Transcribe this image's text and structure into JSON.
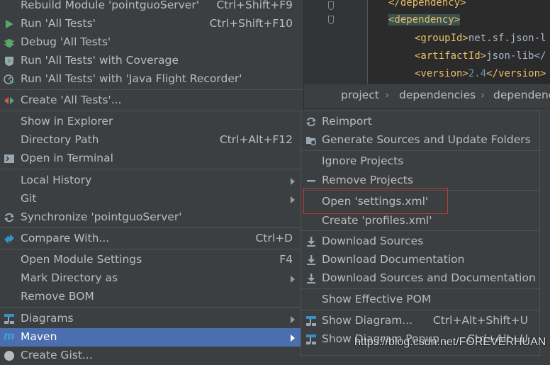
{
  "editor": {
    "line1_tag_close": "</dependency>",
    "line2_tag_open": "<dependency>",
    "line3_tag_open": "<groupId>",
    "line3_text": "net.sf.json-l",
    "line4_tag_open": "<artifactId>",
    "line4_text": "json-lib</",
    "line5_tag_open": "<version>",
    "line5_text": "2.4",
    "line5_tag_close": "</version>"
  },
  "breadcrumb": {
    "items": [
      "project",
      "dependencies",
      "dependenc"
    ]
  },
  "main_menu": {
    "items": [
      {
        "label": "Rebuild Module 'pointguoServer'",
        "shortcut": "Ctrl+Shift+F9"
      },
      {
        "label": "Run 'All Tests'",
        "shortcut": "Ctrl+Shift+F10"
      },
      {
        "label": "Debug 'All Tests'",
        "shortcut": ""
      },
      {
        "label": "Run 'All Tests' with Coverage",
        "shortcut": ""
      },
      {
        "label": "Run 'All Tests' with 'Java Flight Recorder'",
        "shortcut": ""
      },
      {
        "label": "Create 'All Tests'...",
        "shortcut": ""
      },
      {
        "label": "Show in Explorer",
        "shortcut": ""
      },
      {
        "label": "Directory Path",
        "shortcut": "Ctrl+Alt+F12"
      },
      {
        "label": "Open in Terminal",
        "shortcut": ""
      },
      {
        "label": "Local History",
        "shortcut": ""
      },
      {
        "label": "Git",
        "shortcut": ""
      },
      {
        "label": "Synchronize 'pointguoServer'",
        "shortcut": ""
      },
      {
        "label": "Compare With...",
        "shortcut": "Ctrl+D"
      },
      {
        "label": "Open Module Settings",
        "shortcut": "F4"
      },
      {
        "label": "Mark Directory as",
        "shortcut": ""
      },
      {
        "label": "Remove BOM",
        "shortcut": ""
      },
      {
        "label": "Diagrams",
        "shortcut": ""
      },
      {
        "label": "Maven",
        "shortcut": ""
      },
      {
        "label": "Create Gist...",
        "shortcut": ""
      }
    ]
  },
  "sub_menu": {
    "items": [
      {
        "label": "Reimport",
        "shortcut": ""
      },
      {
        "label": "Generate Sources and Update Folders",
        "shortcut": ""
      },
      {
        "label": "Ignore Projects",
        "shortcut": ""
      },
      {
        "label": "Remove Projects",
        "shortcut": ""
      },
      {
        "label": "Open 'settings.xml'",
        "shortcut": ""
      },
      {
        "label": "Create 'profiles.xml'",
        "shortcut": ""
      },
      {
        "label": "Download Sources",
        "shortcut": ""
      },
      {
        "label": "Download Documentation",
        "shortcut": ""
      },
      {
        "label": "Download Sources and Documentation",
        "shortcut": ""
      },
      {
        "label": "Show Effective POM",
        "shortcut": ""
      },
      {
        "label": "Show Diagram...",
        "shortcut": "Ctrl+Alt+Shift+U"
      },
      {
        "label": "Show Diagram Popup...",
        "shortcut": "Ctrl+Alt+U"
      }
    ]
  },
  "watermark": "https://blog.csdn.net/FOREVERHUAN",
  "colors": {
    "menu_bg": "#3c3f41",
    "selection": "#4b6eaf",
    "highlight_box": "#c0392b",
    "editor_bg": "#2b2b2b"
  }
}
